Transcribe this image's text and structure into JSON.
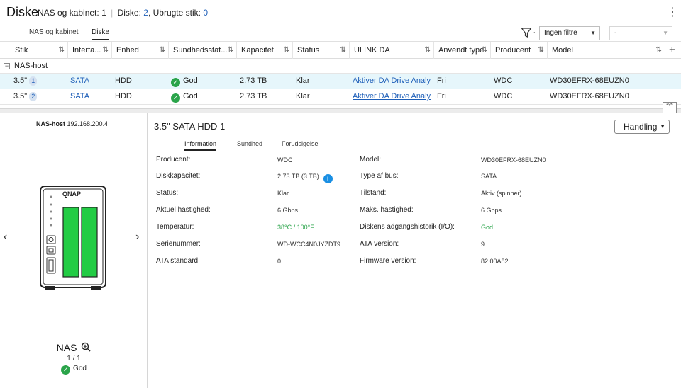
{
  "header": {
    "title": "Diske",
    "nas_label": "NAS og kabinet:",
    "nas_count": "1",
    "disks_label": "Diske:",
    "disks_count": "2",
    "unused_label": ", Ubrugte stik:",
    "unused_count": "0"
  },
  "tabs": [
    {
      "label": "NAS og kabinet"
    },
    {
      "label": "Diske"
    }
  ],
  "filter": {
    "selected": "Ingen filtre",
    "secondary": "-"
  },
  "columns": [
    "Stik",
    "Interfa...",
    "Enhed",
    "Sundhedsstat...",
    "Kapacitet",
    "Status",
    "ULINK DA",
    "Anvendt type",
    "Producent",
    "Model"
  ],
  "group_label": "NAS-host",
  "rows": [
    {
      "slot": "3.5\"",
      "slot_num": "1",
      "interface": "SATA",
      "unit": "HDD",
      "health": "God",
      "capacity": "2.73 TB",
      "status": "Klar",
      "ulink": "Aktiver DA Drive Analy...",
      "type": "Fri",
      "producer": "WDC",
      "model": "WD30EFRX-68EUZN0"
    },
    {
      "slot": "3.5\"",
      "slot_num": "2",
      "interface": "SATA",
      "unit": "HDD",
      "health": "God",
      "capacity": "2.73 TB",
      "status": "Klar",
      "ulink": "Aktiver DA Drive Analy...",
      "type": "Fri",
      "producer": "WDC",
      "model": "WD30EFRX-68EUZN0"
    }
  ],
  "device": {
    "host_name": "NAS-host",
    "host_ip": "192.168.200.4",
    "brand": "QNAP",
    "name": "NAS",
    "count": "1 / 1",
    "status": "God",
    "disk_fill": "#22cc44"
  },
  "detail": {
    "title": "3.5\" SATA HDD 1",
    "action": "Handling",
    "tabs": [
      "Information",
      "Sundhed",
      "Forudsigelse"
    ],
    "left": [
      {
        "label": "Producent:",
        "value": "WDC"
      },
      {
        "label": "Diskkapacitet:",
        "value": "2.73 TB (3 TB)"
      },
      {
        "label": "Status:",
        "value": "Klar"
      },
      {
        "label": "Aktuel hastighed:",
        "value": "6 Gbps"
      },
      {
        "label": "Temperatur:",
        "value": "38°C / 100°F"
      },
      {
        "label": "Serienummer:",
        "value": "WD-WCC4N0JYZDT9"
      },
      {
        "label": "ATA standard:",
        "value": "0"
      }
    ],
    "right": [
      {
        "label": "Model:",
        "value": "WD30EFRX-68EUZN0"
      },
      {
        "label": "Type af bus:",
        "value": "SATA"
      },
      {
        "label": "Tilstand:",
        "value": "Aktiv (spinner)"
      },
      {
        "label": "Maks. hastighed:",
        "value": "6 Gbps"
      },
      {
        "label": "Diskens adgangshistorik (I/O):",
        "value": "God"
      },
      {
        "label": "ATA version:",
        "value": "9"
      },
      {
        "label": "Firmware version:",
        "value": "82.00A82"
      }
    ]
  },
  "colors": {
    "accent": "#1d5eb8",
    "ok": "#2aa44a",
    "selected_row": "#e6f6fb",
    "info": "#1a8fe3"
  }
}
